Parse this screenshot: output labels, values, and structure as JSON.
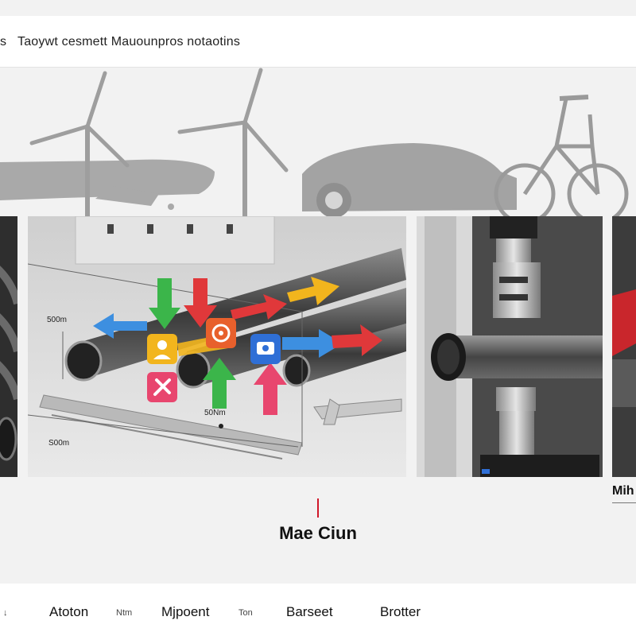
{
  "header": {
    "cut_text": "s",
    "title": "Taoywt cesmett  Mauounpros notaotins"
  },
  "illustration": {
    "measure_labels": [
      "500m",
      "50Nm",
      "S00m"
    ],
    "colors": {
      "blue": "#3d8fe0",
      "green": "#3bb54a",
      "red": "#e0383a",
      "yellow": "#f2b51d",
      "pink": "#e8466e"
    },
    "icons": [
      "person-icon",
      "gear-icon",
      "camera-icon",
      "tools-icon"
    ]
  },
  "center_label": "Mae Ciun",
  "side_label": "Mih",
  "footer": {
    "items": [
      {
        "label": "Atoton",
        "style": "big"
      },
      {
        "label": "Ntm",
        "style": "small"
      },
      {
        "label": "Mjpoent",
        "style": "big"
      },
      {
        "label": "Ton",
        "style": "small"
      },
      {
        "label": "Barseet",
        "style": "big"
      },
      {
        "label": "Brotter",
        "style": "big"
      }
    ],
    "edge_mark": "↓"
  }
}
